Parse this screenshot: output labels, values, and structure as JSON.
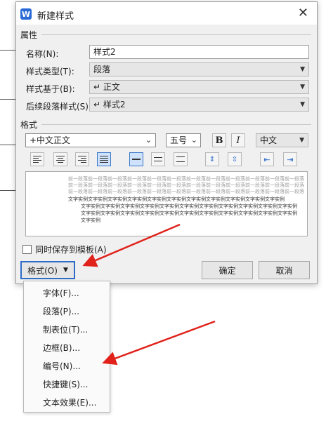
{
  "dialog": {
    "title": "新建样式",
    "app_icon_letter": "W",
    "close_glyph": "✕"
  },
  "properties": {
    "section_label": "属性",
    "name_label": "名称(N):",
    "name_value": "样式2",
    "type_label": "样式类型(T):",
    "type_value": "段落",
    "based_on_label": "样式基于(B):",
    "based_on_value": "↵ 正文",
    "next_style_label": "后续段落样式(S):",
    "next_style_value": "↵ 样式2"
  },
  "format_section": {
    "section_label": "格式",
    "font_value": "+中文正文",
    "size_value": "五号",
    "bold_label": "B",
    "italic_label": "I",
    "script_value": "中文",
    "toolbar_icons": [
      "align-left-icon",
      "align-center-icon",
      "align-right-icon",
      "align-justify-icon",
      "line-spacing-single-icon",
      "line-spacing-1-5-icon",
      "line-spacing-double-icon",
      "space-before-icon",
      "space-after-icon",
      "decrease-indent-icon",
      "increase-indent-icon"
    ]
  },
  "preview": {
    "prev_paragraph": "前一段落前一段落前一段落前一段落前一段落前一段落前一段落前一段落前一段落前一段落前一段落前一段落",
    "sample_text": "文字实例文字实例文字实例文字实例文字实例文字实例文字实例文字实例文字实例文字实例文字实例",
    "tail": "文字实例"
  },
  "footer": {
    "add_to_template_label": "同时保存到模板(A)",
    "format_button_label": "格式(O)",
    "ok_label": "确定",
    "cancel_label": "取消"
  },
  "menu": {
    "items": [
      "字体(F)...",
      "段落(P)...",
      "制表位(T)...",
      "边框(B)...",
      "编号(N)...",
      "快捷键(S)...",
      "文本效果(E)..."
    ]
  },
  "colors": {
    "annotation_arrow": "#e0221b",
    "accent": "#2f6cc8"
  }
}
